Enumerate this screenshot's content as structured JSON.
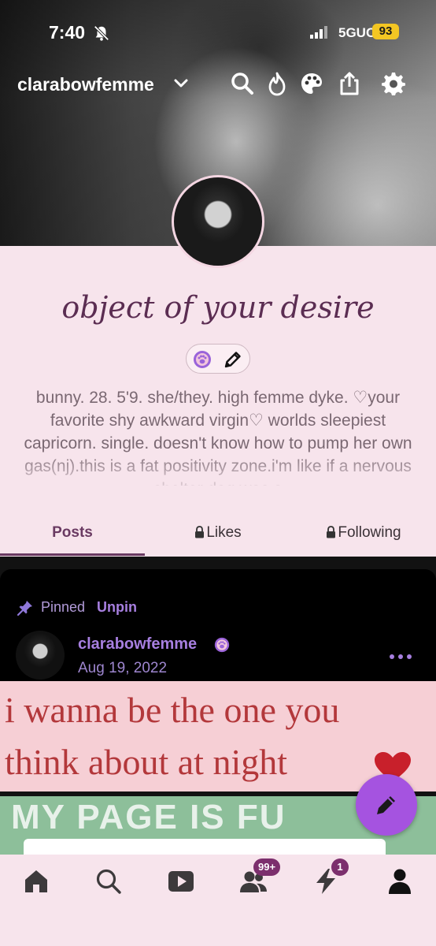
{
  "status_bar": {
    "time": "7:40",
    "network": "5GUC",
    "battery": "93"
  },
  "header": {
    "username": "clarabowfemme"
  },
  "profile": {
    "title": "object of your desire",
    "description": "bunny. 28. 5'9. she/they. high femme dyke. ♡your favorite shy awkward virgin♡ worlds sleepiest capricorn. single. doesn't know how to pump her own gas(nj).this is a fat positivity zone.i'm like if a nervous shelter dog was a"
  },
  "tabs": [
    {
      "label": "Posts",
      "locked": false,
      "active": true
    },
    {
      "label": "Likes",
      "locked": true,
      "active": false
    },
    {
      "label": "Following",
      "locked": true,
      "active": false
    }
  ],
  "post": {
    "pinned_label": "Pinned",
    "unpin_label": "Unpin",
    "author": "clarabowfemme",
    "date": "Aug 19, 2022",
    "image_text_line1": "i wanna be the one you",
    "image_text_line2": "think about at night",
    "image2_text": "MY PAGE IS FU"
  },
  "bottom_nav": {
    "activity_badge": "99+",
    "notifications_badge": "1"
  },
  "colors": {
    "background": "#f7e4ec",
    "title": "#5b2d52",
    "accent_purple": "#a77fe0",
    "fab": "#a553e0",
    "battery": "#f3c623",
    "badge": "#7c2f6d"
  }
}
